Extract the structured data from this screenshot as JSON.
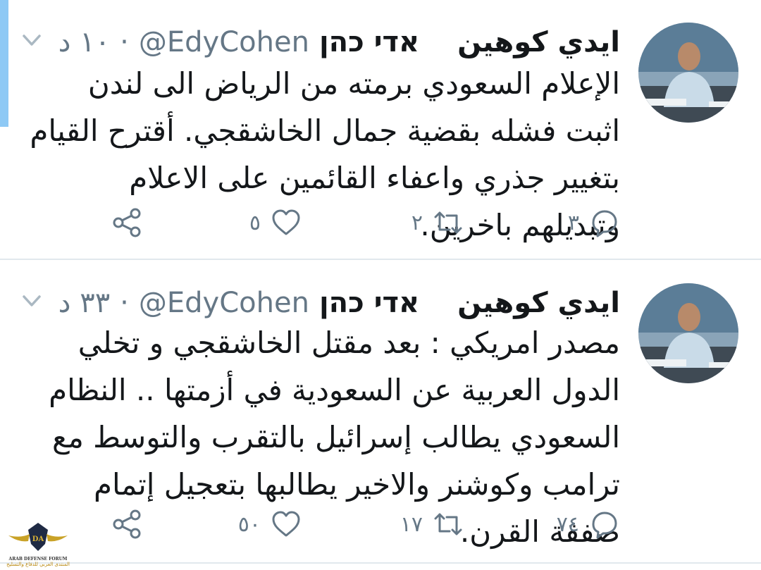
{
  "colors": {
    "accent_bar": "#8ec9f5",
    "text": "#14171a",
    "muted": "#657786",
    "divider": "#e1e8ed"
  },
  "tweets": [
    {
      "display_name": "ايدي كوهين",
      "hebrew_name": "אדי כהן",
      "handle": "@EdyCohen",
      "separator": "·",
      "time": "١٠ د",
      "text": "الإعلام السعودي برمته من الرياض الى لندن اثبت فشله بقضية جمال الخاشقجي. أقترح القيام  بتغيير جذري واعفاء القائمين على الاعلام وتبديلهم باخرين.",
      "replies": "٣",
      "retweets": "٢",
      "likes": "٥",
      "icons": [
        "reply-icon",
        "retweet-icon",
        "like-icon",
        "share-icon",
        "chevron-down-icon"
      ]
    },
    {
      "display_name": "ايدي كوهين",
      "hebrew_name": "אדי כהן",
      "handle": "@EdyCohen",
      "separator": "·",
      "time": "٣٣ د",
      "text": "مصدر امريكي : بعد مقتل الخاشقجي و تخلي الدول العربية عن السعودية في أزمتها .. النظام السعودي يطالب إسرائيل بالتقرب والتوسط مع ترامب وكوشنر والاخير يطالبها بتعجيل إتمام صفقة القرن.",
      "replies": "٧٤",
      "retweets": "١٧",
      "likes": "٥٠",
      "icons": [
        "reply-icon",
        "retweet-icon",
        "like-icon",
        "share-icon",
        "chevron-down-icon"
      ]
    }
  ],
  "watermark": {
    "abbr": "DA",
    "english": "ARAB DEFENSE FORUM",
    "arabic": "المنتدى العربي للدفاع والتسليح"
  }
}
